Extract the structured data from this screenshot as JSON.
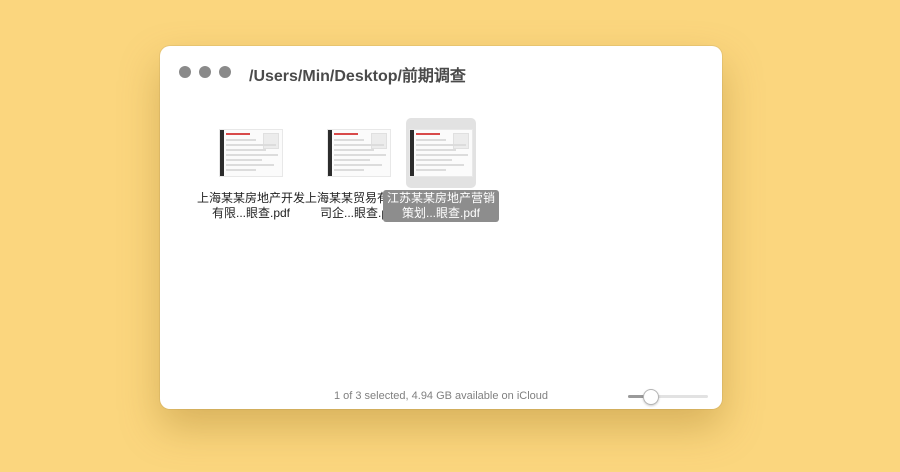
{
  "window": {
    "title": "/Users/Min/Desktop/前期调查"
  },
  "files": [
    {
      "name": "上海某某房地产开发有限...眼查.pdf",
      "selected": false
    },
    {
      "name": "上海某某贸易有限公司企...眼查.pdf",
      "selected": false
    },
    {
      "name": "江苏某某房地产营销策划...眼查.pdf",
      "selected": true
    }
  ],
  "status_bar": {
    "text": "1 of 3 selected, 4.94 GB available on iCloud"
  },
  "icon_size_slider": {
    "value": 0.28
  },
  "colors": {
    "desktop_background": "#fbd67e",
    "selection_label": "#8d8d8d"
  }
}
